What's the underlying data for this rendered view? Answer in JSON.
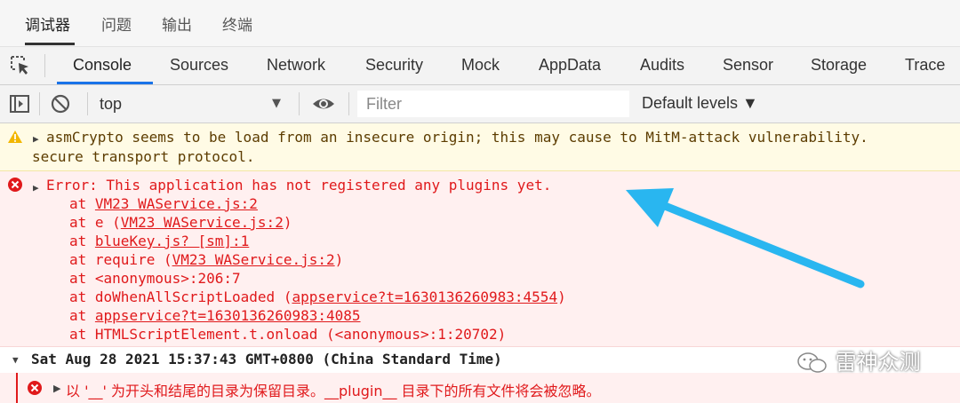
{
  "top_tabs": [
    {
      "label": "调试器",
      "active": true
    },
    {
      "label": "问题",
      "active": false
    },
    {
      "label": "输出",
      "active": false
    },
    {
      "label": "终端",
      "active": false
    }
  ],
  "panel_tabs": [
    {
      "label": "Console",
      "active": true
    },
    {
      "label": "Sources"
    },
    {
      "label": "Network"
    },
    {
      "label": "Security"
    },
    {
      "label": "Mock"
    },
    {
      "label": "AppData"
    },
    {
      "label": "Audits"
    },
    {
      "label": "Sensor"
    },
    {
      "label": "Storage"
    },
    {
      "label": "Trace"
    }
  ],
  "toolbar": {
    "context": "top",
    "filter_placeholder": "Filter",
    "levels_label": "Default levels ▼"
  },
  "warning": {
    "line1": "asmCrypto seems to be load from an insecure origin; this may cause to MitM-attack vulnerability.",
    "line2": "secure transport protocol."
  },
  "error": {
    "message": "Error: This application has not registered any plugins yet.",
    "stack": [
      {
        "prefix": "at ",
        "link": "VM23 WAService.js:2",
        "suffix": ""
      },
      {
        "prefix": "at e (",
        "link": "VM23 WAService.js:2",
        "suffix": ")"
      },
      {
        "prefix": "at ",
        "link": "blueKey.js? [sm]:1",
        "suffix": ""
      },
      {
        "prefix": "at require (",
        "link": "VM23 WAService.js:2",
        "suffix": ")"
      },
      {
        "prefix": "at <anonymous>:206:7",
        "link": "",
        "suffix": ""
      },
      {
        "prefix": "at doWhenAllScriptLoaded (",
        "link": "appservice?t=1630136260983:4554",
        "suffix": ")"
      },
      {
        "prefix": "at ",
        "link": "appservice?t=1630136260983:4085",
        "suffix": ""
      },
      {
        "prefix": "at HTMLScriptElement.t.onload (<anonymous>:1:20702)",
        "link": "",
        "suffix": ""
      }
    ]
  },
  "group": {
    "header": "Sat Aug 28 2021 15:37:43 GMT+0800 (China Standard Time)"
  },
  "group_error": {
    "message": "以 '__' 为开头和结尾的目录为保留目录。__plugin__ 目录下的所有文件将会被忽略。"
  },
  "watermark": "雷神众测",
  "colors": {
    "accent": "#1a73e8",
    "error": "#e0191b",
    "warning_text": "#5c3c00",
    "annotation_arrow": "#29b6f0"
  }
}
